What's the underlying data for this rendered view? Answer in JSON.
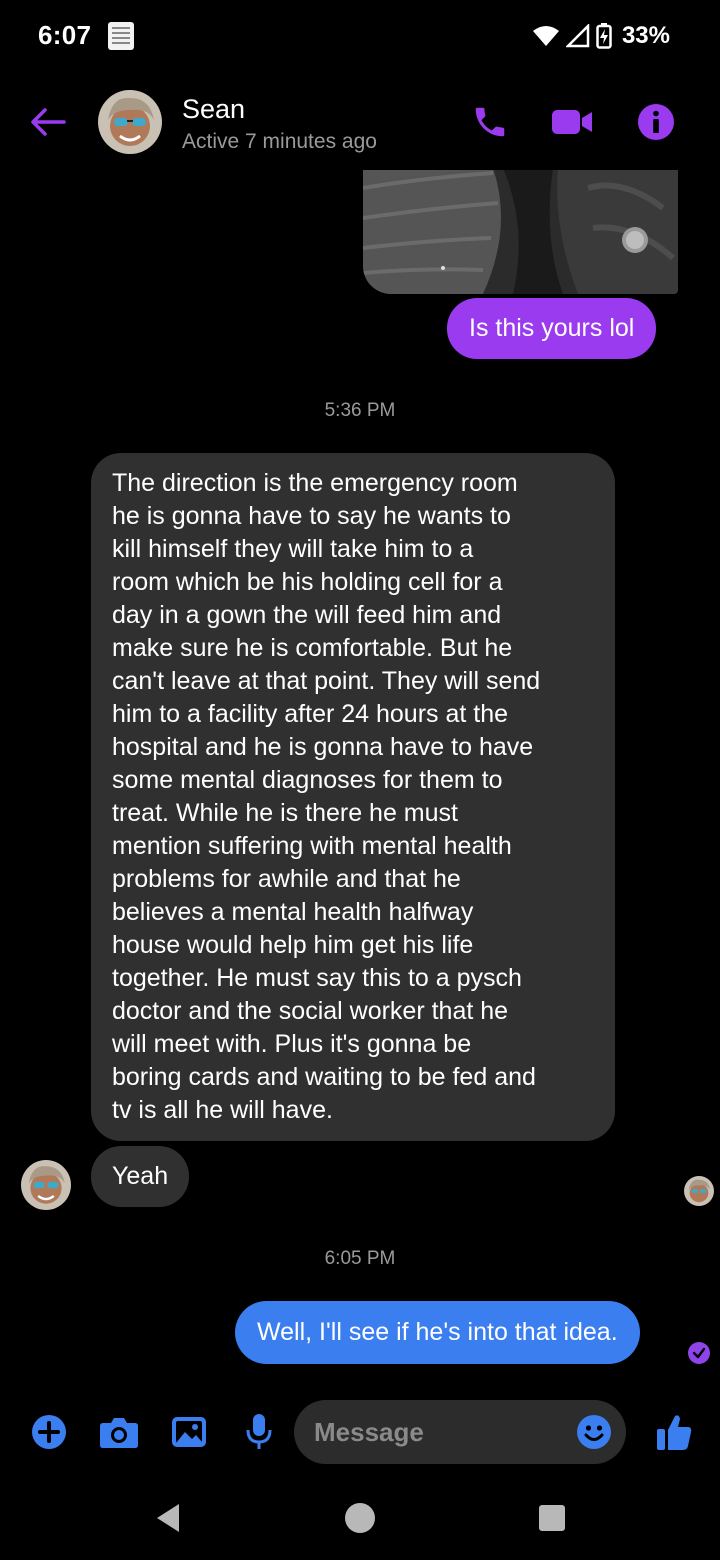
{
  "status_bar": {
    "time": "6:07",
    "battery": "33%"
  },
  "header": {
    "contact_name": "Sean",
    "contact_status": "Active 7 minutes ago"
  },
  "messages": {
    "photo_caption": "Is this yours lol",
    "timestamp_1": "5:36 PM",
    "received_long": [
      "The direction is the emergency room",
      "he is gonna have to say he wants to",
      "kill himself they will take him to a",
      "room which be his holding cell for a",
      "day in a gown the will feed him and",
      "make sure he is comfortable. But he",
      "can't leave at that point. They will send",
      "him to a facility after 24 hours at the",
      "hospital and he is gonna have to have",
      "some mental diagnoses for them to",
      "treat. While he is there he must",
      "mention suffering with mental health",
      "problems for awhile and that he",
      "believes a mental health halfway",
      "house would help him get his life",
      "together. He must say this to a pysch",
      "doctor and the social worker that he",
      "will meet with.   Plus it's gonna be",
      "boring cards and waiting to be fed and",
      "tv is all he will have."
    ],
    "received_short": "Yeah",
    "timestamp_2": "6:05 PM",
    "sent_last": "Well, I'll see if he's into that idea."
  },
  "composer": {
    "placeholder": "Message"
  },
  "colors": {
    "accent_purple": "#9b3bf0",
    "sent_blue": "#3b7ef0",
    "received_gray": "#303030",
    "composer_blue": "#3b7ef0"
  },
  "icons": [
    "back-arrow-icon",
    "phone-icon",
    "video-icon",
    "info-icon",
    "plus-icon",
    "camera-icon",
    "gallery-icon",
    "mic-icon",
    "emoji-icon",
    "like-icon",
    "nav-back-icon",
    "nav-home-icon",
    "nav-recents-icon"
  ]
}
